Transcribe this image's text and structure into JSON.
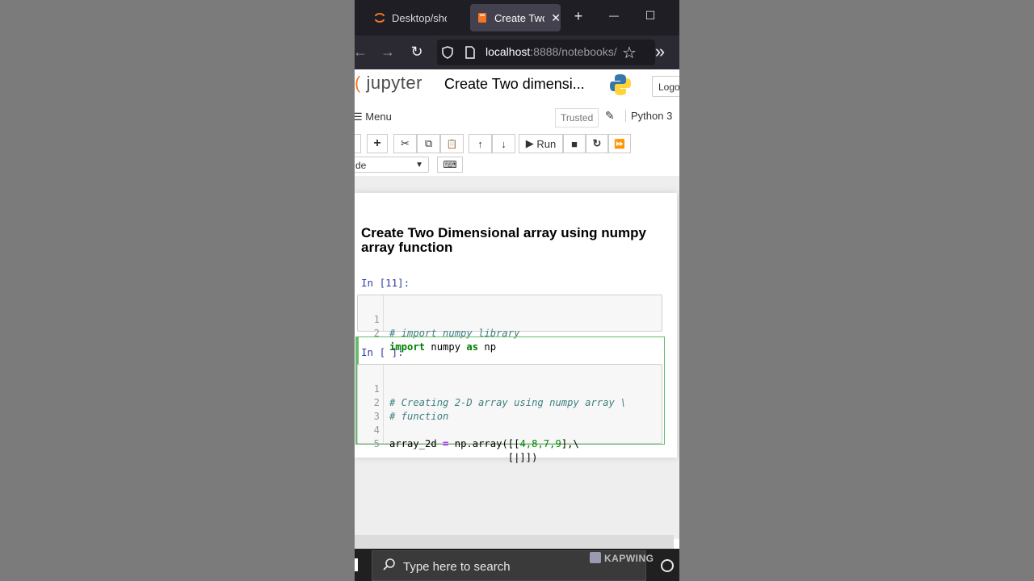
{
  "browser": {
    "tabs": [
      {
        "label": "Desktop/short",
        "active": false
      },
      {
        "label": "Create Two",
        "active": true
      }
    ],
    "new_tab": "+",
    "minimize": "—",
    "maximize": "☐",
    "url_host": "localhost",
    "url_rest": ":8888/notebooks/",
    "back": "←",
    "forward": "→",
    "reload": "↻",
    "overflow": "»",
    "bookmark": "☆"
  },
  "jupyter": {
    "logo_text": "jupyter",
    "notebook_title": "Create Two dimensi...",
    "logout_label": "Logo",
    "menu_label": "Menu",
    "trusted_label": "Trusted",
    "kernel_label": "Python 3",
    "toolbar": {
      "run_label": "Run",
      "cell_type": "de",
      "add": "+",
      "cut": "✂",
      "copy": "⧉",
      "paste": "📋",
      "up": "↑",
      "down": "↓",
      "stop": "■",
      "restart": "↻",
      "fast_forward": "⏩",
      "keyboard": "⌨"
    }
  },
  "notebook": {
    "heading": "Create Two Dimensional array using numpy array function",
    "cell1": {
      "prompt": "In [11]:",
      "lines": [
        {
          "n": "1",
          "comment": "# import numpy library"
        },
        {
          "n": "2",
          "kw1": "import",
          "mid": " numpy ",
          "kw2": "as",
          "end": " np"
        }
      ]
    },
    "cell2": {
      "prompt": "In [ ]:",
      "lines": [
        {
          "n": "1",
          "comment": "# Creating 2-D array using numpy array \\"
        },
        {
          "n": "2",
          "comment": "# function"
        },
        {
          "n": "3"
        },
        {
          "n": "4",
          "a": "array_2d ",
          "op": "=",
          "b": " np.array([[",
          "nums": "4,8,7,9",
          "c": "],\\"
        },
        {
          "n": "5",
          "indent": "                    ",
          "d": "[|]])"
        }
      ]
    }
  },
  "taskbar": {
    "search_placeholder": "Type here to search",
    "watermark": "KAPWING"
  }
}
